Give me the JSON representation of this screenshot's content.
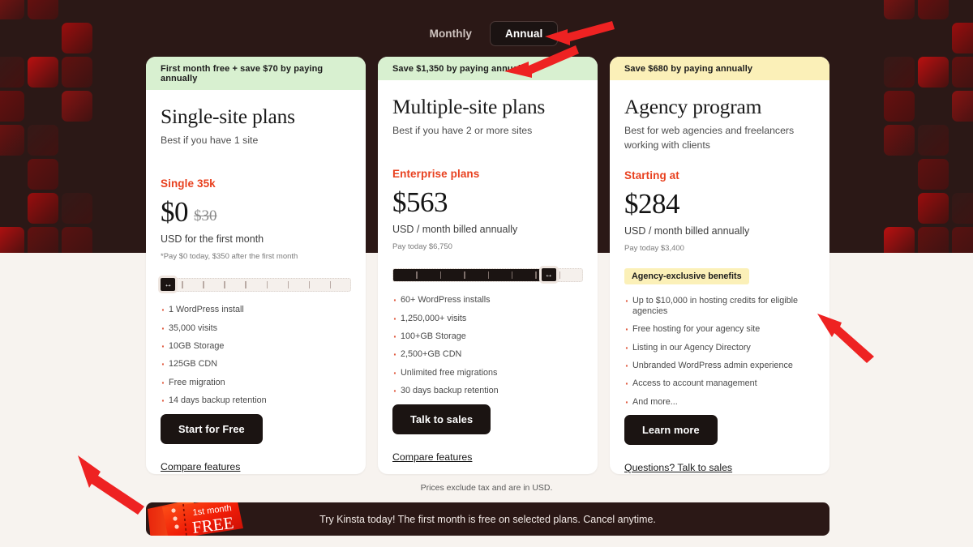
{
  "billing_toggle": {
    "options": [
      {
        "label": "Monthly",
        "active": false
      },
      {
        "label": "Annual",
        "active": true
      }
    ]
  },
  "cards": [
    {
      "banner": "First month free + save $70 by paying annually",
      "banner_style": "green",
      "title": "Single-site plans",
      "subtitle": "Best if you have 1 site",
      "plan_name": "Single 35k",
      "price": "$0",
      "price_old": "$30",
      "price_unit": "USD for the first month",
      "price_note": "*Pay $0 today, $350 after the first month",
      "slider": {
        "position_pct": 4,
        "ticks": 8
      },
      "badge": null,
      "features": [
        "1 WordPress install",
        "35,000 visits",
        "10GB Storage",
        "125GB CDN",
        "Free migration",
        "14 days backup retention"
      ],
      "cta_label": "Start for Free",
      "link_label": "Compare features"
    },
    {
      "banner": "Save $1,350 by paying annually",
      "banner_style": "green",
      "title": "Multiple-site plans",
      "subtitle": "Best if you have 2 or more sites",
      "plan_name": "Enterprise plans",
      "price": "$563",
      "price_old": null,
      "price_unit": "USD / month billed annually",
      "price_note": "Pay today $6,750",
      "slider": {
        "position_pct": 82,
        "ticks": 7
      },
      "badge": null,
      "features": [
        "60+ WordPress installs",
        "1,250,000+ visits",
        "100+GB Storage",
        "2,500+GB CDN",
        "Unlimited free migrations",
        "30 days backup retention"
      ],
      "cta_label": "Talk to sales",
      "link_label": "Compare features"
    },
    {
      "banner": "Save $680 by paying annually",
      "banner_style": "yellow",
      "title": "Agency program",
      "subtitle": "Best for web agencies and freelancers working with clients",
      "plan_name": "Starting at",
      "price": "$284",
      "price_old": null,
      "price_unit": "USD / month billed annually",
      "price_note": "Pay today $3,400",
      "slider": null,
      "badge": "Agency-exclusive benefits",
      "features": [
        "Up to $10,000 in hosting credits for eligible agencies",
        "Free hosting for your agency site",
        "Listing in our Agency Directory",
        "Unbranded WordPress admin experience",
        "Access to account management",
        "And more..."
      ],
      "cta_label": "Learn more",
      "link_label": "Questions? Talk to sales"
    }
  ],
  "footnote": "Prices exclude tax and are in USD.",
  "promo": {
    "text": "Try Kinsta today! The first month is free on selected plans. Cancel anytime.",
    "ticket_line1": "1st month",
    "ticket_line2": "FREE"
  },
  "colors": {
    "accent_red": "#e8411f",
    "dark": "#2b1816",
    "banner_green": "#d8f0d0",
    "banner_yellow": "#fbf0b8",
    "cream": "#f7f3ef",
    "annotation_arrow": "#ee2222"
  }
}
